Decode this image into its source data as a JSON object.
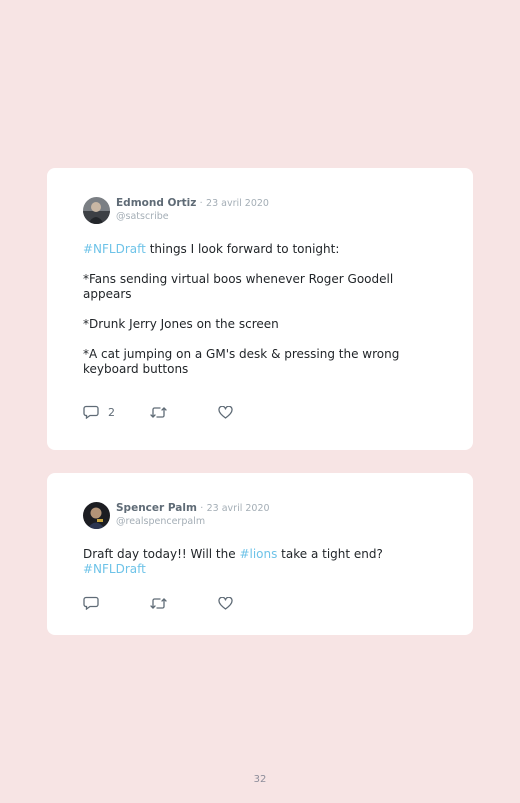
{
  "tweets": [
    {
      "author": "Edmond Ortiz",
      "separator": "·",
      "date": "23 avril 2020",
      "handle": "@satscribe",
      "hashtag_1": "#NFLDraft",
      "line_1_rest": " things I look forward to tonight:",
      "para_2": "*Fans sending virtual boos whenever Roger Goodell appears",
      "para_3": "*Drunk Jerry Jones on the screen",
      "para_4": "*A cat jumping on a GM's desk & pressing the wrong keyboard buttons",
      "reply_count": "2",
      "icons": {
        "reply": "comment-icon",
        "retweet": "retweet-icon",
        "like": "heart-icon"
      }
    },
    {
      "author": "Spencer Palm",
      "separator": "·",
      "date": "23 avril 2020",
      "handle": "@realspencerpalm",
      "text_1": "Draft day today!! Will the ",
      "hashtag_1": "#lions",
      "text_2": " take a tight end? ",
      "hashtag_2": "#NFLDraft",
      "icons": {
        "reply": "comment-icon",
        "retweet": "retweet-icon",
        "like": "heart-icon"
      }
    }
  ],
  "page_number": "32",
  "colors": {
    "background": "#f7e4e4",
    "card": "#ffffff",
    "hashtag": "#6ec3e8",
    "author": "#5f6b76",
    "meta": "#a4aeb6"
  }
}
